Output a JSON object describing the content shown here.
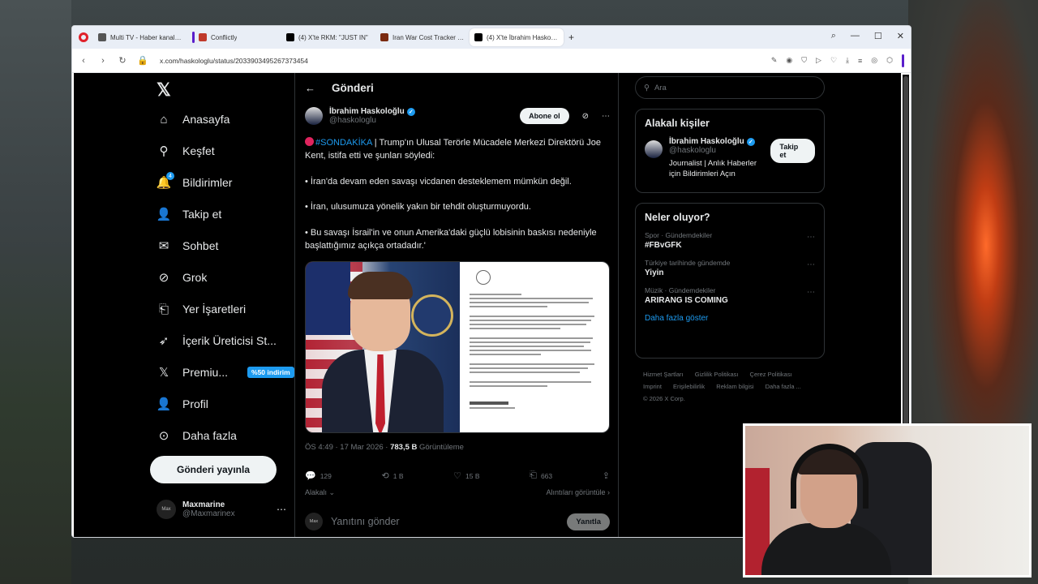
{
  "browser": {
    "tabs": [
      {
        "label": "Multi TV - Haber kanalları",
        "fav_color": "#555555"
      },
      {
        "label": "Conflictly",
        "fav_color": "#c0392b"
      },
      {
        "label": "(4) X'te RKM: \"JUST IN\"",
        "fav_color": "#000000"
      },
      {
        "label": "Iran War Cost Tracker — |",
        "fav_color": "#7a2a10"
      },
      {
        "label": "(4) X'te İbrahim Haskoğlu",
        "fav_color": "#000000"
      }
    ],
    "new_tab": "+",
    "url": "x.com/haskologlu/status/2033903495267373454"
  },
  "nav": {
    "items": [
      {
        "label": "Anasayfa",
        "icon": "home-icon",
        "glyph": "⌂"
      },
      {
        "label": "Keşfet",
        "icon": "search-icon",
        "glyph": "🔍"
      },
      {
        "label": "Bildirimler",
        "icon": "bell-icon",
        "glyph": "🔔",
        "badge": "4"
      },
      {
        "label": "Takip et",
        "icon": "follow-icon",
        "glyph": "👤"
      },
      {
        "label": "Sohbet",
        "icon": "mail-icon",
        "glyph": "✉"
      },
      {
        "label": "Grok",
        "icon": "grok-icon",
        "glyph": "⊘"
      },
      {
        "label": "Yer İşaretleri",
        "icon": "bookmark-icon",
        "glyph": "🔖"
      },
      {
        "label": "İçerik Üreticisi St...",
        "icon": "rocket-icon",
        "glyph": "🚀"
      },
      {
        "label": "Premiu...",
        "icon": "x-premium-icon",
        "glyph": "X",
        "promo": "%50 indirim"
      },
      {
        "label": "Profil",
        "icon": "profile-icon",
        "glyph": "👤"
      },
      {
        "label": "Daha fazla",
        "icon": "more-circle-icon",
        "glyph": "⋯"
      }
    ],
    "post_button": "Gönderi yayınla",
    "account": {
      "name": "Maxmarine",
      "handle": "@Maxmarinex",
      "avatar_text": "Max"
    }
  },
  "post": {
    "header_title": "Gönderi",
    "author_name": "İbrahim Haskoloğlu",
    "author_handle": "@haskologlu",
    "subscribe": "Abone ol",
    "hashtag": "#SONDAKİKA",
    "text_1": " | Trump'ın Ulusal Terörle Mücadele Merkezi Direktörü Joe Kent, istifa etti ve şunları söyledi:",
    "text_2": "• İran'da devam eden savaşı vicdanen desteklemem mümkün değil.",
    "text_3": "• İran, ulusumuza yönelik yakın bir tehdit oluşturmuyordu.",
    "text_4": "• Bu savaşı İsrail'in ve onun Amerika'daki güçlü lobisinin baskısı nedeniyle başlattığımız açıkça ortadadır.'",
    "time": "ÖS 4:49 · 17 Mar 2026 · ",
    "views": "783,5 B",
    "views_label": " Görüntüleme",
    "replies": "129",
    "reposts": "1 B",
    "likes": "15 B",
    "bookmarks": "663",
    "sort_label": "Alakalı",
    "quotes_label": "Alıntıları görüntüle",
    "reply_placeholder": "Yanıtını gönder",
    "reply_button": "Yanıtla"
  },
  "sidebar": {
    "search_placeholder": "Ara",
    "related_title": "Alakalı kişiler",
    "person_name": "İbrahim Haskoloğlu",
    "person_handle": "@haskologlu",
    "person_bio": "Journalist | Anlık Haberler için Bildirimleri Açın",
    "follow": "Takip et",
    "trends_title": "Neler oluyor?",
    "trends": [
      {
        "context": "Spor · Gündemdekiler",
        "topic": "#FBvGFK"
      },
      {
        "context": "Türkiye tarihinde gündemde",
        "topic": "Yiyin"
      },
      {
        "context": "Müzik · Gündemdekiler",
        "topic": "ARIRANG IS COMING"
      }
    ],
    "show_more": "Daha fazla göster",
    "footer": [
      "Hizmet Şartları",
      "Gizlilik Politikası",
      "Çerez Politikası",
      "Imprint",
      "Erişilebilirlik",
      "Reklam bilgisi",
      "Daha fazla ...",
      "© 2026 X Corp."
    ]
  },
  "colors": {
    "accent": "#1d9bf0",
    "background": "#000000",
    "text": "#e7e9ea",
    "muted": "#71767b",
    "breaking_dot": "#e0245e"
  }
}
